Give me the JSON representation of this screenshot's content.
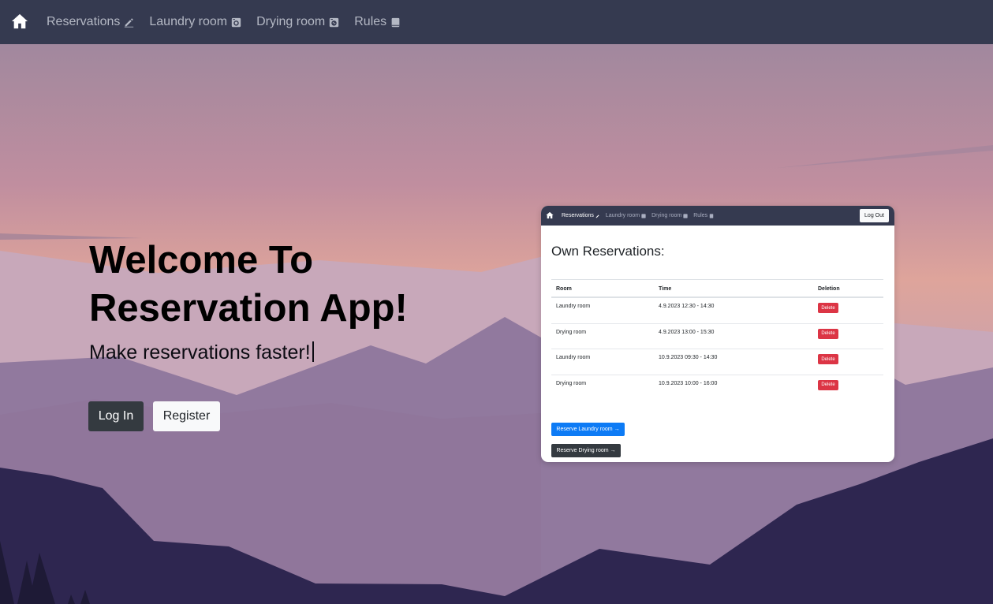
{
  "navbar": {
    "home_icon": "home-icon",
    "links": [
      {
        "label": "Reservations",
        "icon": "pencil-icon"
      },
      {
        "label": "Laundry room",
        "icon": "washer-icon"
      },
      {
        "label": "Drying room",
        "icon": "dryer-icon"
      },
      {
        "label": "Rules",
        "icon": "book-icon"
      }
    ]
  },
  "hero": {
    "title": "Welcome To Reservation App!",
    "subtitle": "Make reservations faster!",
    "login_label": "Log In",
    "register_label": "Register"
  },
  "preview": {
    "nav_links": [
      "Reservations",
      "Laundry room",
      "Drying room",
      "Rules"
    ],
    "logout_label": "Log Out",
    "heading": "Own Reservations:",
    "columns": [
      "Room",
      "Time",
      "Deletion"
    ],
    "rows": [
      {
        "room": "Laundry room",
        "time": "4.9.2023 12:30 - 14:30",
        "action": "Delete"
      },
      {
        "room": "Drying room",
        "time": "4.9.2023 13:00 - 15:30",
        "action": "Delete"
      },
      {
        "room": "Laundry room",
        "time": "10.9.2023 09:30 - 14:30",
        "action": "Delete"
      },
      {
        "room": "Drying room",
        "time": "10.9.2023 10:00 - 16:00",
        "action": "Delete"
      }
    ],
    "reserve_laundry_label": "Reserve Laundry room →",
    "reserve_drying_label": "Reserve Drying room →"
  },
  "colors": {
    "navbar_bg": "#353a50",
    "sky_top": "#a1889e",
    "sky_glow": "#e9ad98",
    "delete_red": "#dc3545",
    "primary_blue": "#0d7bf5",
    "dark_button": "#343a40"
  }
}
